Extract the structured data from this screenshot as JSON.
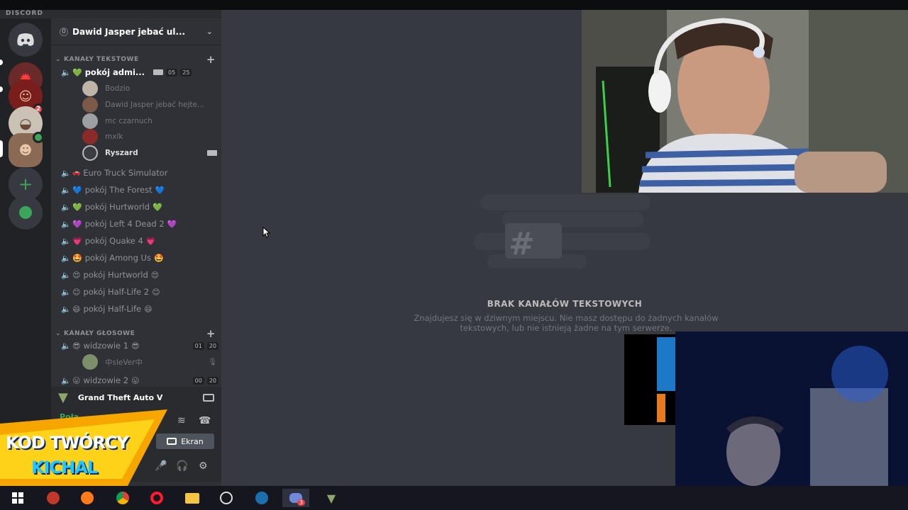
{
  "app": {
    "brand": "DISCORD"
  },
  "rail": {
    "badges": [
      "1",
      "2"
    ]
  },
  "guild": {
    "name": "Dawid Jasper jebać ul...",
    "boost": "0"
  },
  "categories": {
    "text": "KANAŁY TEKSTOWE",
    "voice": "KANAŁY GŁOSOWE"
  },
  "admin_channel": {
    "name": "pokój admi...",
    "emoji": "💚",
    "count_a": "05",
    "count_b": "25"
  },
  "admin_users": [
    {
      "name": "Bodzio"
    },
    {
      "name": "Dawid Jasper jebać hejte..."
    },
    {
      "name": "mc czarnuch"
    },
    {
      "name": "mxlk"
    },
    {
      "name": "Ryszard"
    }
  ],
  "channels": [
    {
      "emoji": "🚗",
      "name": "Euro Truck Simulator",
      "emoji_after": ""
    },
    {
      "emoji": "💙",
      "name": "pokój The Forest",
      "emoji_after": "💙"
    },
    {
      "emoji": "💚",
      "name": "pokój Hurtworld",
      "emoji_after": "💚"
    },
    {
      "emoji": "💜",
      "name": "pokój Left 4 Dead 2",
      "emoji_after": "💜"
    },
    {
      "emoji": "💗",
      "name": "pokój Quake 4",
      "emoji_after": "💗"
    },
    {
      "emoji": "🤩",
      "name": "pokój Among Us",
      "emoji_after": "🤩"
    },
    {
      "emoji": "😍",
      "name": "pokój Hurtworld",
      "emoji_after": "😍"
    },
    {
      "emoji": "😊",
      "name": "pokój Half-Life 2",
      "emoji_after": "😊"
    },
    {
      "emoji": "😄",
      "name": "pokój Half-Life",
      "emoji_after": "😄"
    }
  ],
  "voice_channels": [
    {
      "emoji": "😎",
      "name": "widzowie 1",
      "emoji_after": "😎",
      "count_a": "01",
      "count_b": "20"
    },
    {
      "emoji": "😛",
      "name": "widzowie 2",
      "emoji_after": "😛",
      "count_a": "00",
      "count_b": "20"
    }
  ],
  "voice_users": [
    {
      "name": "中sleVer中"
    }
  ],
  "now_playing": {
    "game": "Grand Theft Auto V"
  },
  "voice_bar": {
    "status": "Połą...",
    "screen_label": "Ekran"
  },
  "main": {
    "empty_title": "BRAK KANAŁÓW TEKSTOWYCH",
    "empty_desc": "Znajdujesz się w dziwnym miejscu. Nie masz dostępu do żadnych kanałów tekstowych, lub nie istnieją żadne na tym serwerze."
  },
  "promo": {
    "line1": "KOD TWÓRCY",
    "line2": "KICHAL"
  },
  "taskbar": {
    "discord_badge": "3"
  },
  "colors": {
    "accent": "#5865f2",
    "online": "#3ba55c",
    "promo_orange": "#f7a600",
    "promo_blue": "#20c8ff"
  }
}
